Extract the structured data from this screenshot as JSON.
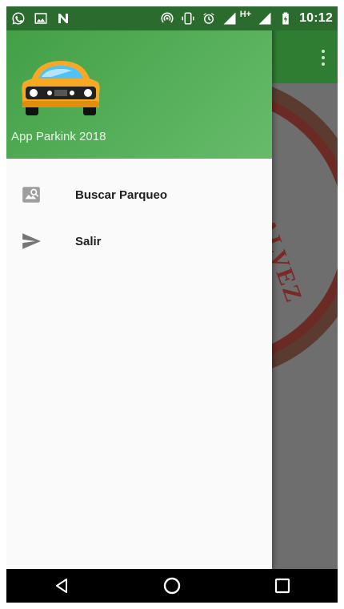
{
  "status_bar": {
    "time": "10:12",
    "network": "H+",
    "left_icons": [
      "whatsapp-icon",
      "gallery-icon",
      "n-icon"
    ],
    "right_icons": [
      "hotspot-icon",
      "vibrate-icon",
      "alarm-icon",
      "signal-icon",
      "signal-icon",
      "battery-icon"
    ]
  },
  "drawer": {
    "app_name": "App Parkink 2018",
    "menu": [
      {
        "label": "Buscar Parqueo",
        "icon": "image-search-icon"
      },
      {
        "label": "Salir",
        "icon": "send-icon"
      }
    ]
  },
  "background": {
    "seal_text": "GALVEZ"
  },
  "nav_bar": {
    "buttons": [
      "back-icon",
      "home-icon",
      "recents-icon"
    ]
  },
  "colors": {
    "status_bar": "#2b6b2d",
    "toolbar": "#2e7d32",
    "header_start": "#43a047",
    "header_end": "#66bb6a",
    "drawer_bg": "#fafafa",
    "scrim": "#6e6e6e"
  }
}
